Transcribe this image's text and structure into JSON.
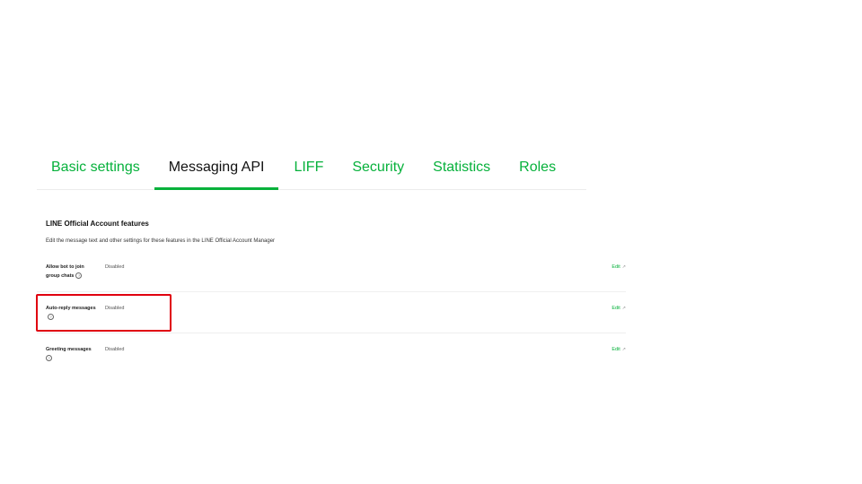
{
  "tabs": [
    {
      "label": "Basic settings",
      "active": false
    },
    {
      "label": "Messaging API",
      "active": true
    },
    {
      "label": "LIFF",
      "active": false
    },
    {
      "label": "Security",
      "active": false
    },
    {
      "label": "Statistics",
      "active": false
    },
    {
      "label": "Roles",
      "active": false
    }
  ],
  "section": {
    "title": "LINE Official Account features",
    "description": "Edit the message text and other settings for these features in the LINE Official Account Manager"
  },
  "rows": [
    {
      "label": "Allow bot to join group chats",
      "value": "Disabled",
      "action": "Edit"
    },
    {
      "label": "Auto-reply messages",
      "value": "Disabled",
      "action": "Edit"
    },
    {
      "label": "Greeting messages",
      "value": "Disabled",
      "action": "Edit"
    }
  ],
  "icons": {
    "help": "question-circle-icon",
    "external": "external-link-icon"
  },
  "colors": {
    "accent": "#06b13b",
    "highlight": "#e0000f"
  }
}
